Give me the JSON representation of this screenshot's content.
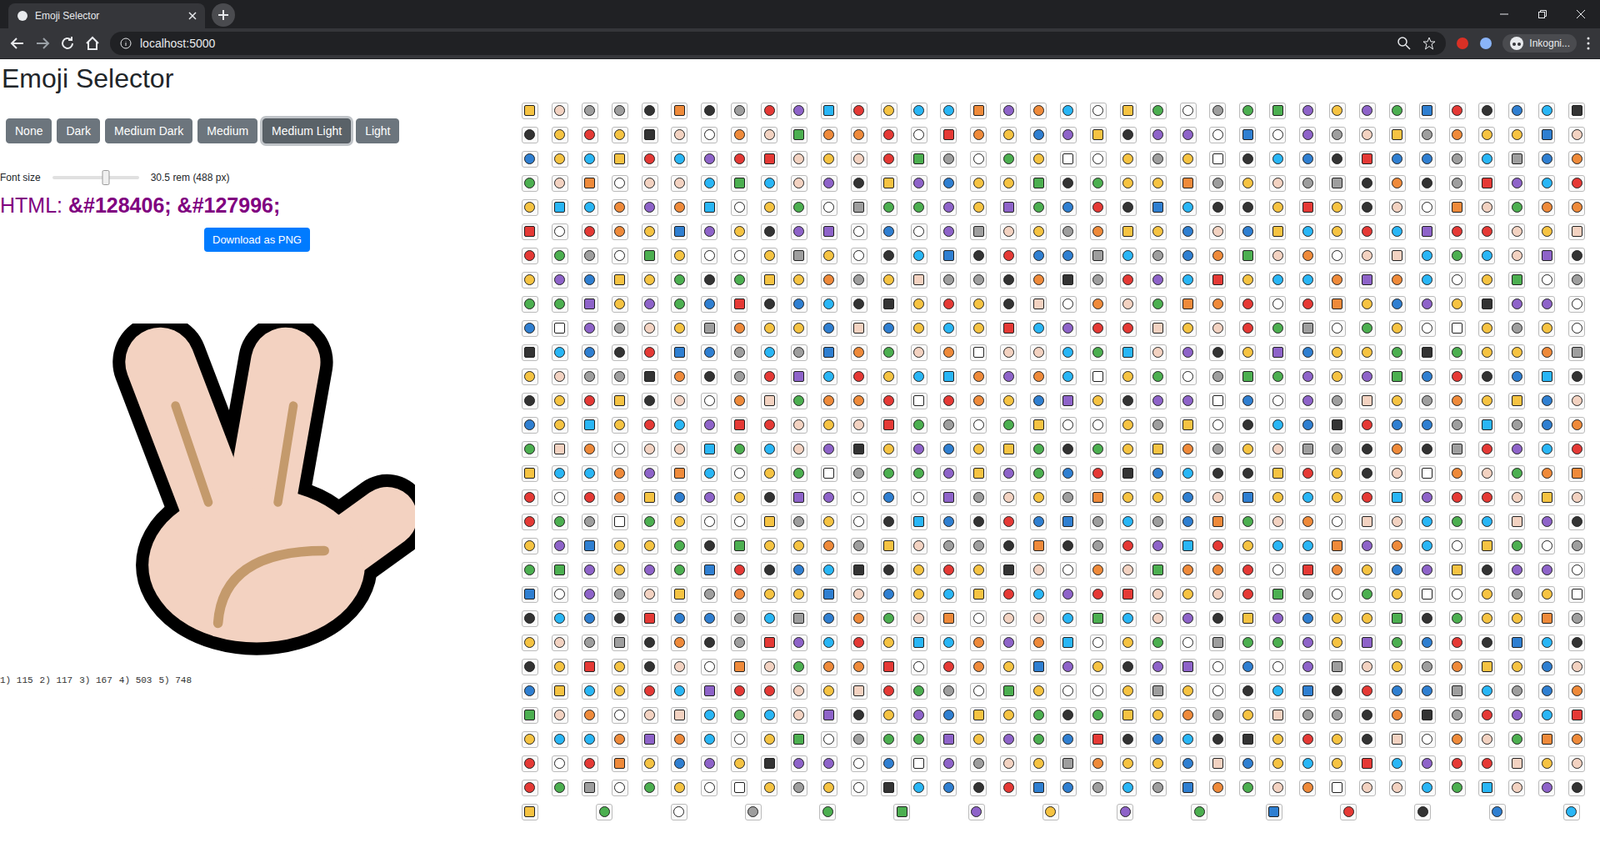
{
  "browser": {
    "tab_title": "Emoji Selector",
    "url": "localhost:5000",
    "profile": "Inkogni..."
  },
  "page": {
    "title": "Emoji Selector"
  },
  "tones": [
    {
      "label": "None",
      "selected": false
    },
    {
      "label": "Dark",
      "selected": false
    },
    {
      "label": "Medium Dark",
      "selected": false
    },
    {
      "label": "Medium",
      "selected": false
    },
    {
      "label": "Medium Light",
      "selected": true
    },
    {
      "label": "Light",
      "selected": false
    }
  ],
  "font_size": {
    "label": "Font size",
    "level": 0.62,
    "reading": "30.5 rem (488 px)"
  },
  "html_code": {
    "label": "HTML:",
    "value": "&#128406; &#127996;"
  },
  "download_button": "Download as PNG",
  "stats": [
    "1) 115",
    "2) 117",
    "3) 167",
    "4) 503",
    "5) 748"
  ]
}
